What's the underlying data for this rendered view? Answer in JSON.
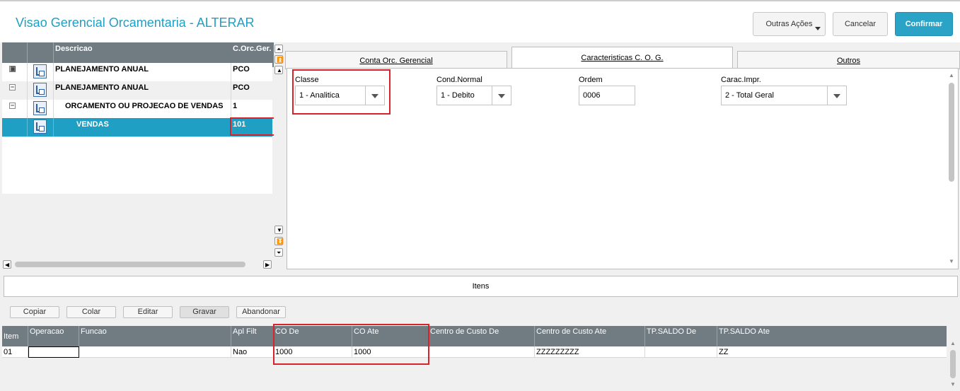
{
  "header": {
    "title": "Visao Gerencial Orcamentaria - ALTERAR",
    "other_actions_label": "Outras Ações",
    "cancel_label": "Cancelar",
    "confirm_label": "Confirmar"
  },
  "tree": {
    "columns": [
      "Descricao",
      "C.Orc.Ger."
    ],
    "rows": [
      {
        "description": "PLANEJAMENTO ANUAL",
        "code": "PCO",
        "indent": 0
      },
      {
        "description": "PLANEJAMENTO ANUAL",
        "code": "PCO",
        "indent": 0
      },
      {
        "description": "ORCAMENTO OU PROJECAO DE VENDAS",
        "code": "1",
        "indent": 1
      },
      {
        "description": "VENDAS",
        "code": "101",
        "indent": 2,
        "selected": true
      }
    ]
  },
  "tabs": [
    {
      "label": "Conta Orc. Gerencial",
      "active": false
    },
    {
      "label": "Caracteristicas C. O. G.",
      "active": true
    },
    {
      "label": "Outros",
      "active": false
    }
  ],
  "form": {
    "classe": {
      "label": "Classe",
      "value": "1 - Analitica"
    },
    "cond_normal": {
      "label": "Cond.Normal",
      "value": "1 - Debito"
    },
    "ordem": {
      "label": "Ordem",
      "value": "0006"
    },
    "carac_impr": {
      "label": "Carac.Impr.",
      "value": "2 - Total Geral"
    }
  },
  "itens": {
    "title": "Itens",
    "actions": [
      "Copiar",
      "Colar",
      "Editar",
      "Gravar",
      "Abandonar"
    ],
    "columns": [
      "Item",
      "Operacao",
      "Funcao",
      "Apl Filt",
      "CO De",
      "CO Ate",
      "Centro de Custo De",
      "Centro de Custo Ate",
      "TP.SALDO De",
      "TP.SALDO Ate"
    ],
    "rows": [
      [
        "01",
        "",
        "",
        "Nao",
        "1000",
        "1000",
        "",
        "ZZZZZZZZZ",
        "",
        "ZZ"
      ]
    ]
  },
  "colors": {
    "accent": "#1f9fc4",
    "highlight_border": "#d8232a",
    "header_bg": "#707b82"
  }
}
